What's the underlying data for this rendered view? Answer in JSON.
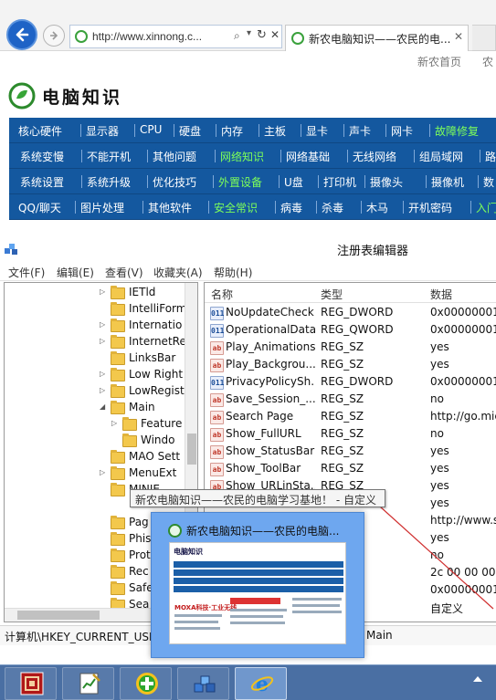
{
  "browser": {
    "address": "http://www.xinnong.c...",
    "tab_title": "新农电脑知识——农民的电..."
  },
  "page": {
    "top_links": [
      "新农首页",
      "农"
    ],
    "logo_text": "电脑知识",
    "nav_rows": [
      [
        "核心硬件",
        "显示器",
        "CPU",
        "硬盘",
        "内存",
        "主板",
        "显卡",
        "声卡",
        "网卡",
        "故障修复"
      ],
      [
        "系统变慢",
        "不能开机",
        "其他问题",
        "网络知识",
        "网络基础",
        "无线网络",
        "组局域网",
        "路"
      ],
      [
        "系统设置",
        "系统升级",
        "优化技巧",
        "外置设备",
        "U盘",
        "打印机",
        "摄像头",
        "摄像机",
        "数"
      ],
      [
        "QQ/聊天",
        "图片处理",
        "其他软件",
        "安全常识",
        "病毒",
        "杀毒",
        "木马",
        "开机密码",
        "入门"
      ]
    ],
    "nav_highlight_color": "#7dff5a",
    "nav_bg_color": "#14589f"
  },
  "regedit": {
    "title": "注册表编辑器",
    "menu": [
      "文件(F)",
      "编辑(E)",
      "查看(V)",
      "收藏夹(A)",
      "帮助(H)"
    ],
    "tree": [
      {
        "label": "IETld",
        "expander": "▷"
      },
      {
        "label": "IntelliForm",
        "expander": ""
      },
      {
        "label": "Internatio",
        "expander": "▷"
      },
      {
        "label": "InternetRe",
        "expander": "▷"
      },
      {
        "label": "LinksBar",
        "expander": ""
      },
      {
        "label": "Low Right",
        "expander": "▷"
      },
      {
        "label": "LowRegist",
        "expander": "▷"
      },
      {
        "label": "Main",
        "expander": "◢"
      },
      {
        "label": "Feature",
        "expander": "▷"
      },
      {
        "label": "Windo",
        "expander": ""
      },
      {
        "label": "MAO Sett",
        "expander": ""
      },
      {
        "label": "MenuExt",
        "expander": "▷"
      },
      {
        "label": "MINIE",
        "expander": ""
      },
      {
        "label": "",
        "expander": ""
      },
      {
        "label": "Pag",
        "expander": ""
      },
      {
        "label": "Phis",
        "expander": ""
      },
      {
        "label": "Prot",
        "expander": ""
      },
      {
        "label": "Rec",
        "expander": ""
      },
      {
        "label": "Safe",
        "expander": ""
      },
      {
        "label": "Sea",
        "expander": ""
      }
    ],
    "columns": {
      "name": "名称",
      "type": "类型",
      "data": "数据"
    },
    "values": [
      {
        "icon": "binary-value-icon",
        "glyph": "011",
        "kind": "bin",
        "name": "NoUpdateCheck",
        "type": "REG_DWORD",
        "data": "0x00000001"
      },
      {
        "icon": "binary-value-icon",
        "glyph": "011",
        "kind": "bin",
        "name": "OperationalData",
        "type": "REG_QWORD",
        "data": "0x00000001"
      },
      {
        "icon": "string-value-icon",
        "glyph": "ab",
        "kind": "sz",
        "name": "Play_Animations",
        "type": "REG_SZ",
        "data": "yes"
      },
      {
        "icon": "string-value-icon",
        "glyph": "ab",
        "kind": "sz",
        "name": "Play_Backgrou...",
        "type": "REG_SZ",
        "data": "yes"
      },
      {
        "icon": "binary-value-icon",
        "glyph": "011",
        "kind": "bin",
        "name": "PrivacyPolicySh...",
        "type": "REG_DWORD",
        "data": "0x00000001"
      },
      {
        "icon": "string-value-icon",
        "glyph": "ab",
        "kind": "sz",
        "name": "Save_Session_...",
        "type": "REG_SZ",
        "data": "no"
      },
      {
        "icon": "string-value-icon",
        "glyph": "ab",
        "kind": "sz",
        "name": "Search Page",
        "type": "REG_SZ",
        "data": "http://go.mic"
      },
      {
        "icon": "string-value-icon",
        "glyph": "ab",
        "kind": "sz",
        "name": "Show_FullURL",
        "type": "REG_SZ",
        "data": "no"
      },
      {
        "icon": "string-value-icon",
        "glyph": "ab",
        "kind": "sz",
        "name": "Show_StatusBar",
        "type": "REG_SZ",
        "data": "yes"
      },
      {
        "icon": "string-value-icon",
        "glyph": "ab",
        "kind": "sz",
        "name": "Show_ToolBar",
        "type": "REG_SZ",
        "data": "yes"
      },
      {
        "icon": "string-value-icon",
        "glyph": "ab",
        "kind": "sz",
        "name": "Show_URLinSta...",
        "type": "REG_SZ",
        "data": "yes"
      },
      {
        "icon": "",
        "glyph": "",
        "kind": "",
        "name": "",
        "type": "",
        "data": "yes"
      },
      {
        "icon": "",
        "glyph": "",
        "kind": "",
        "name": "",
        "type": "",
        "data": "http://www.s"
      },
      {
        "icon": "",
        "glyph": "",
        "kind": "",
        "name": "",
        "type": "",
        "data": "yes"
      },
      {
        "icon": "",
        "glyph": "",
        "kind": "",
        "name": "",
        "type": "",
        "data": "no"
      },
      {
        "icon": "",
        "glyph": "",
        "kind": "",
        "name": "",
        "type": "ARY",
        "data": "2c 00 00 00 0"
      },
      {
        "icon": "",
        "glyph": "",
        "kind": "",
        "name": "",
        "type": "ORD",
        "data": "0x00000001"
      },
      {
        "icon": "",
        "glyph": "",
        "kind": "",
        "name": "",
        "type": "",
        "data": "自定义"
      }
    ],
    "status_path": "计算机\\HKEY_CURRENT_USE",
    "status_tail": "Main"
  },
  "tooltip": {
    "text": "新农电脑知识——农民的电脑学习基地！ - 自定义"
  },
  "thumbnail": {
    "title": "新农电脑知识——农民的电脑...",
    "logo": "电脑知识",
    "ad_text": "MOXA科技·工业无线"
  },
  "taskbar": {
    "items": [
      {
        "name": "taskbar-app-red",
        "icon": "red-grid-app-icon",
        "active": false
      },
      {
        "name": "taskbar-app-notepad",
        "icon": "chart-notepad-icon",
        "active": false
      },
      {
        "name": "taskbar-app-green",
        "icon": "green-plus-icon",
        "active": false
      },
      {
        "name": "taskbar-app-regedit",
        "icon": "regedit-cubes-icon",
        "active": false
      },
      {
        "name": "taskbar-app-ie",
        "icon": "internet-explorer-icon",
        "active": true
      }
    ]
  }
}
